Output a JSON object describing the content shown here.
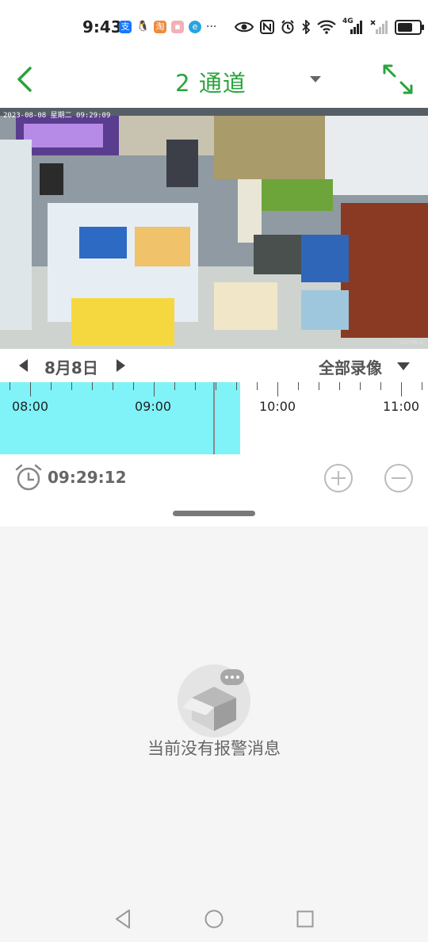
{
  "status_bar": {
    "time": "9:43",
    "more": "···",
    "network": "4G",
    "battery_level": 0.8,
    "icons": [
      "alipay-icon",
      "qq-icon",
      "app-icon",
      "app-icon",
      "app-icon",
      "eye-icon",
      "nfc-icon",
      "alarm-icon",
      "bluetooth-icon",
      "wifi-icon",
      "signal-icon",
      "signal-off-icon",
      "battery-icon"
    ]
  },
  "header": {
    "title": "2 通道",
    "accent_color": "#2aa33c"
  },
  "video": {
    "osd_text": "2023-08-08  星期二  09:29:09",
    "watermark": "camera"
  },
  "date_nav": {
    "date": "8月8日",
    "record_type": "全部录像"
  },
  "timeline": {
    "labels": [
      "08:00",
      "09:00",
      "10:00",
      "11:00"
    ],
    "recorded_color": "#7ff3f8"
  },
  "playback": {
    "current_time": "09:29:12"
  },
  "alarms": {
    "empty_text": "当前没有报警消息"
  }
}
